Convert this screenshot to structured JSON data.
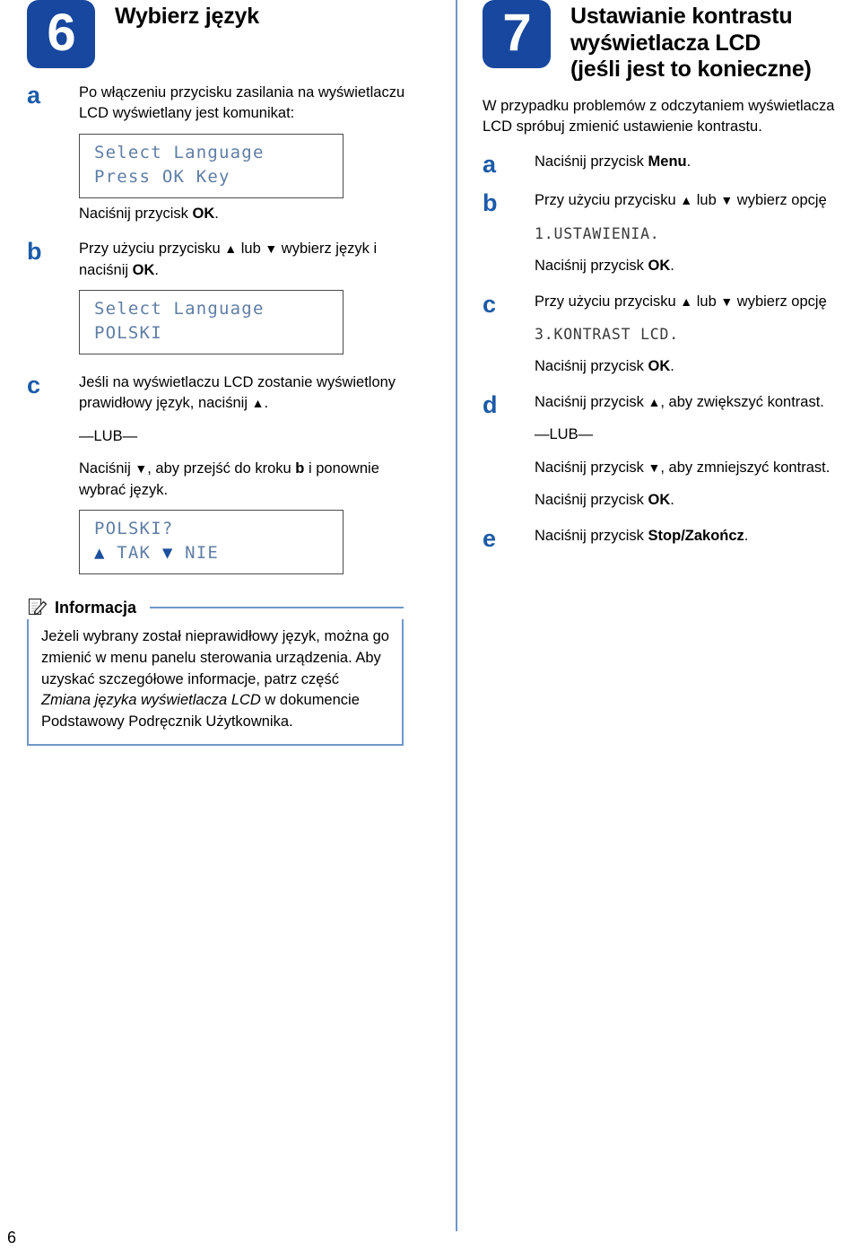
{
  "page": {
    "number": "6",
    "divider_color": "#6f97c8",
    "badge_color": "#17479e",
    "letter_color": "#1c5ba8",
    "lcd_text_color": "#5f7da5"
  },
  "left_column": {
    "step": {
      "number": "6",
      "title_lines": [
        "Wybierz język"
      ]
    },
    "substeps": [
      {
        "letter": "a",
        "paragraphs": [
          "Po włączeniu przycisku zasilania na wyświetlaczu LCD wyświetlany jest komunikat:"
        ],
        "lcd": {
          "lines": [
            "Select Language",
            "Press OK Key"
          ]
        },
        "after": "Naciśnij przycisk OK."
      },
      {
        "letter": "b",
        "paragraphs": [
          "Przy użyciu przycisku ▲ lub ▼ wybierz język i naciśnij OK."
        ],
        "lcd": {
          "lines": [
            "Select Language",
            "POLSKI"
          ]
        }
      },
      {
        "letter": "c",
        "paragraphs": [
          "Jeśli na wyświetlaczu LCD zostanie wyświetlony prawidłowy język, naciśnij ▲.",
          "—LUB—",
          "Naciśnij ▼, aby przejść do kroku b i ponownie wybrać język."
        ],
        "lcd": {
          "lines": [
            "POLSKI?",
            "▲ TAK ▼ NIE"
          ]
        }
      }
    ],
    "note": {
      "icon": "note-pencil-icon",
      "title": "Informacja",
      "text_parts": [
        {
          "style": "normal",
          "text": "Jeżeli wybrany został nieprawidłowy język, można go zmienić w menu panelu sterowania urządzenia. Aby uzyskać szczegółowe informacje, patrz część "
        },
        {
          "style": "italic",
          "text": "Zmiana języka wyświetlacza LCD"
        },
        {
          "style": "normal",
          "text": " w dokumencie Podstawowy Podręcznik Użytkownika."
        }
      ]
    }
  },
  "right_column": {
    "step": {
      "number": "7",
      "title_lines": [
        "Ustawianie kontrastu",
        "wyświetlacza LCD",
        "(jeśli jest to konieczne)"
      ]
    },
    "intro": "W przypadku problemów z odczytaniem wyświetlacza LCD spróbuj zmienić ustawienie kontrastu.",
    "substeps": [
      {
        "letter": "a",
        "lines": [
          {
            "type": "text",
            "before": "Naciśnij przycisk ",
            "bold": "Menu",
            "after": "."
          }
        ]
      },
      {
        "letter": "b",
        "lines": [
          {
            "type": "text",
            "before": "Przy użyciu przycisku ▲ lub ▼ wybierz opcję",
            "bold": "",
            "after": ""
          },
          {
            "type": "mono",
            "text": "1.USTAWIENIA."
          },
          {
            "type": "text",
            "before": "Naciśnij przycisk ",
            "bold": "OK",
            "after": "."
          }
        ]
      },
      {
        "letter": "c",
        "lines": [
          {
            "type": "text",
            "before": "Przy użyciu przycisku ▲ lub ▼ wybierz opcję",
            "bold": "",
            "after": ""
          },
          {
            "type": "mono",
            "text": "3.KONTRAST LCD."
          },
          {
            "type": "text",
            "before": "Naciśnij przycisk ",
            "bold": "OK",
            "after": "."
          }
        ]
      },
      {
        "letter": "d",
        "lines": [
          {
            "type": "text",
            "before": "Naciśnij przycisk ▲, aby zwiększyć kontrast.",
            "bold": "",
            "after": ""
          },
          {
            "type": "text",
            "before": "—LUB—",
            "bold": "",
            "after": ""
          },
          {
            "type": "text",
            "before": "Naciśnij przycisk ▼, aby zmniejszyć kontrast.",
            "bold": "",
            "after": ""
          },
          {
            "type": "text",
            "before": "Naciśnij przycisk ",
            "bold": "OK",
            "after": "."
          }
        ]
      },
      {
        "letter": "e",
        "lines": [
          {
            "type": "text",
            "before": "Naciśnij przycisk ",
            "bold": "Stop/Zakończ",
            "after": "."
          }
        ]
      }
    ]
  }
}
